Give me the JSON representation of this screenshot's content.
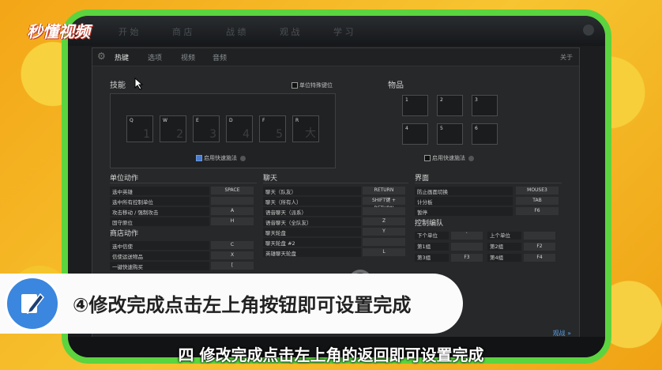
{
  "logo": "秒懂视频",
  "top_strip": {
    "items": [
      "开 始",
      "商 店",
      "战 绩",
      "观 战",
      "学 习"
    ]
  },
  "tabs": [
    {
      "label": "热键"
    },
    {
      "label": "选项"
    },
    {
      "label": "视频"
    },
    {
      "label": "音频"
    }
  ],
  "about": "关于",
  "skills": {
    "title": "技能",
    "unit_position_label": "单位特殊键位",
    "slots": [
      {
        "key": "Q",
        "num": "1"
      },
      {
        "key": "W",
        "num": "2"
      },
      {
        "key": "E",
        "num": "3"
      },
      {
        "key": "D",
        "num": "4"
      },
      {
        "key": "F",
        "num": "5"
      },
      {
        "key": "R",
        "num": "大"
      }
    ],
    "quickcast_label": "启用快速施法"
  },
  "items": {
    "title": "物品",
    "slots": [
      "1",
      "2",
      "3",
      "4",
      "5",
      "6"
    ],
    "quickcast_label": "启用快速施法"
  },
  "unit_actions": {
    "title": "单位动作",
    "rows": [
      {
        "label": "选中英雄",
        "key": "SPACE"
      },
      {
        "label": "选中所有控制单位",
        "key": ""
      },
      {
        "label": "攻击移动 / 强制攻击",
        "key": "A"
      },
      {
        "label": "固守原位",
        "key": "H"
      }
    ]
  },
  "shop_actions": {
    "title": "商店动作",
    "rows": [
      {
        "label": "选中信使",
        "key": "C"
      },
      {
        "label": "信使运送物品",
        "key": "X"
      },
      {
        "label": "一键快速购买",
        "key": "["
      }
    ]
  },
  "chat": {
    "title": "聊天",
    "rows": [
      {
        "label": "聊天（队友）",
        "key": "RETURN"
      },
      {
        "label": "聊天（所有人）",
        "key": "SHIFT键 + RETURN"
      },
      {
        "label": "语音聊天（派系）",
        "key": ""
      },
      {
        "label": "语音聊天（全队友）",
        "key": "Z"
      },
      {
        "label": "聊天轮盘",
        "key": "Y"
      },
      {
        "label": "聊天轮盘 #2",
        "key": ""
      },
      {
        "label": "英雄聊天轮盘",
        "key": "L"
      }
    ]
  },
  "interface": {
    "title": "界面",
    "rows": [
      {
        "label": "防止画面切换",
        "key": "MOUSE3"
      },
      {
        "label": "计分板",
        "key": "TAB"
      },
      {
        "label": "暂停",
        "key": "F6"
      }
    ]
  },
  "control_groups": {
    "title": "控制编队",
    "rows": [
      {
        "l1": "下个单位",
        "k1": "`",
        "l2": "上个单位",
        "k2": ""
      },
      {
        "l1": "第1组",
        "k1": "",
        "l2": "第2组",
        "k2": "F2"
      },
      {
        "l1": "第3组",
        "k1": "F3",
        "l2": "第4组",
        "k2": "F4"
      }
    ]
  },
  "spectate": "观战 »",
  "banner": {
    "text": "④修改完成点击左上角按钮即可设置完成"
  },
  "subtitle": "四 修改完成点击左上角的返回即可设置完成"
}
